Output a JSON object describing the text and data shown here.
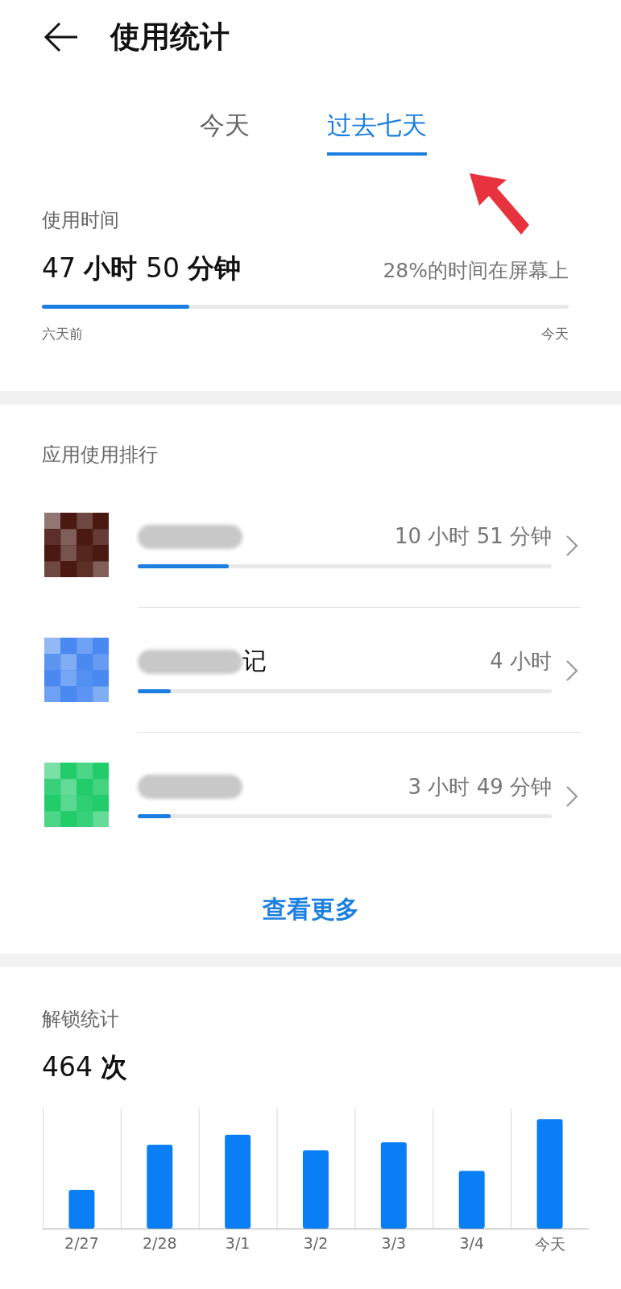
{
  "header": {
    "title": "使用统计"
  },
  "tabs": [
    {
      "label": "今天",
      "selected": false
    },
    {
      "label": "过去七天",
      "selected": true
    }
  ],
  "annotations": [
    {
      "kind": "arrow",
      "color": "#e8333f"
    }
  ],
  "usage_time": {
    "heading": "使用时间",
    "total": "47 **小时** 50 **分钟**",
    "share": "28%的时间在屏幕上",
    "level": 0.28,
    "start_label": "六天前",
    "end_label": "今天"
  },
  "app_ranking": {
    "heading": "应用使用排行",
    "more": "查看更多",
    "apps": [
      {
        "color": "#4a1a12",
        "duration": "10 小时 51 分钟",
        "level": 0.22
      },
      {
        "color": "#4a8af0",
        "name": "记",
        "duration": "4 小时",
        "level": 0.08
      },
      {
        "color": "#22cc6a",
        "duration": "3 小时 49 分钟",
        "level": 0.08
      }
    ]
  },
  "unlocks": {
    "heading": "解锁统计",
    "count": "464 **次**",
    "day_labels": [
      "2/27",
      "2/28",
      "3/1",
      "3/2",
      "3/3",
      "3/4",
      "今天"
    ]
  }
}
